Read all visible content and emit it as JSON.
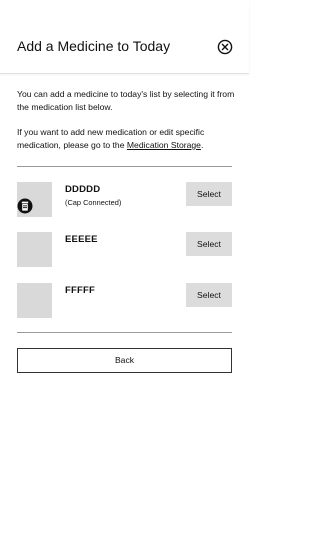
{
  "header": {
    "title": "Add a Medicine to Today",
    "close_icon": "close-circle-icon"
  },
  "intro": {
    "paragraph1": "You can add a medicine to today's list by selecting it from the medication list below.",
    "paragraph2_prefix": "If you want to add new medication or edit specific medication, please go to the ",
    "paragraph2_link": "Medication Storage",
    "paragraph2_suffix": "."
  },
  "medications": [
    {
      "name": "DDDDD",
      "subtitle": "(Cap Connected)",
      "icon": "cap-connected-icon",
      "select_label": "Select"
    },
    {
      "name": "EEEEE",
      "subtitle": "",
      "icon": "",
      "select_label": "Select"
    },
    {
      "name": "FFFFF",
      "subtitle": "",
      "icon": "",
      "select_label": "Select"
    }
  ],
  "footer": {
    "back_label": "Back"
  },
  "colors": {
    "placeholder": "#d9d9d9",
    "select_button": "#dcdcdc",
    "divider": "#9a9a9a"
  }
}
